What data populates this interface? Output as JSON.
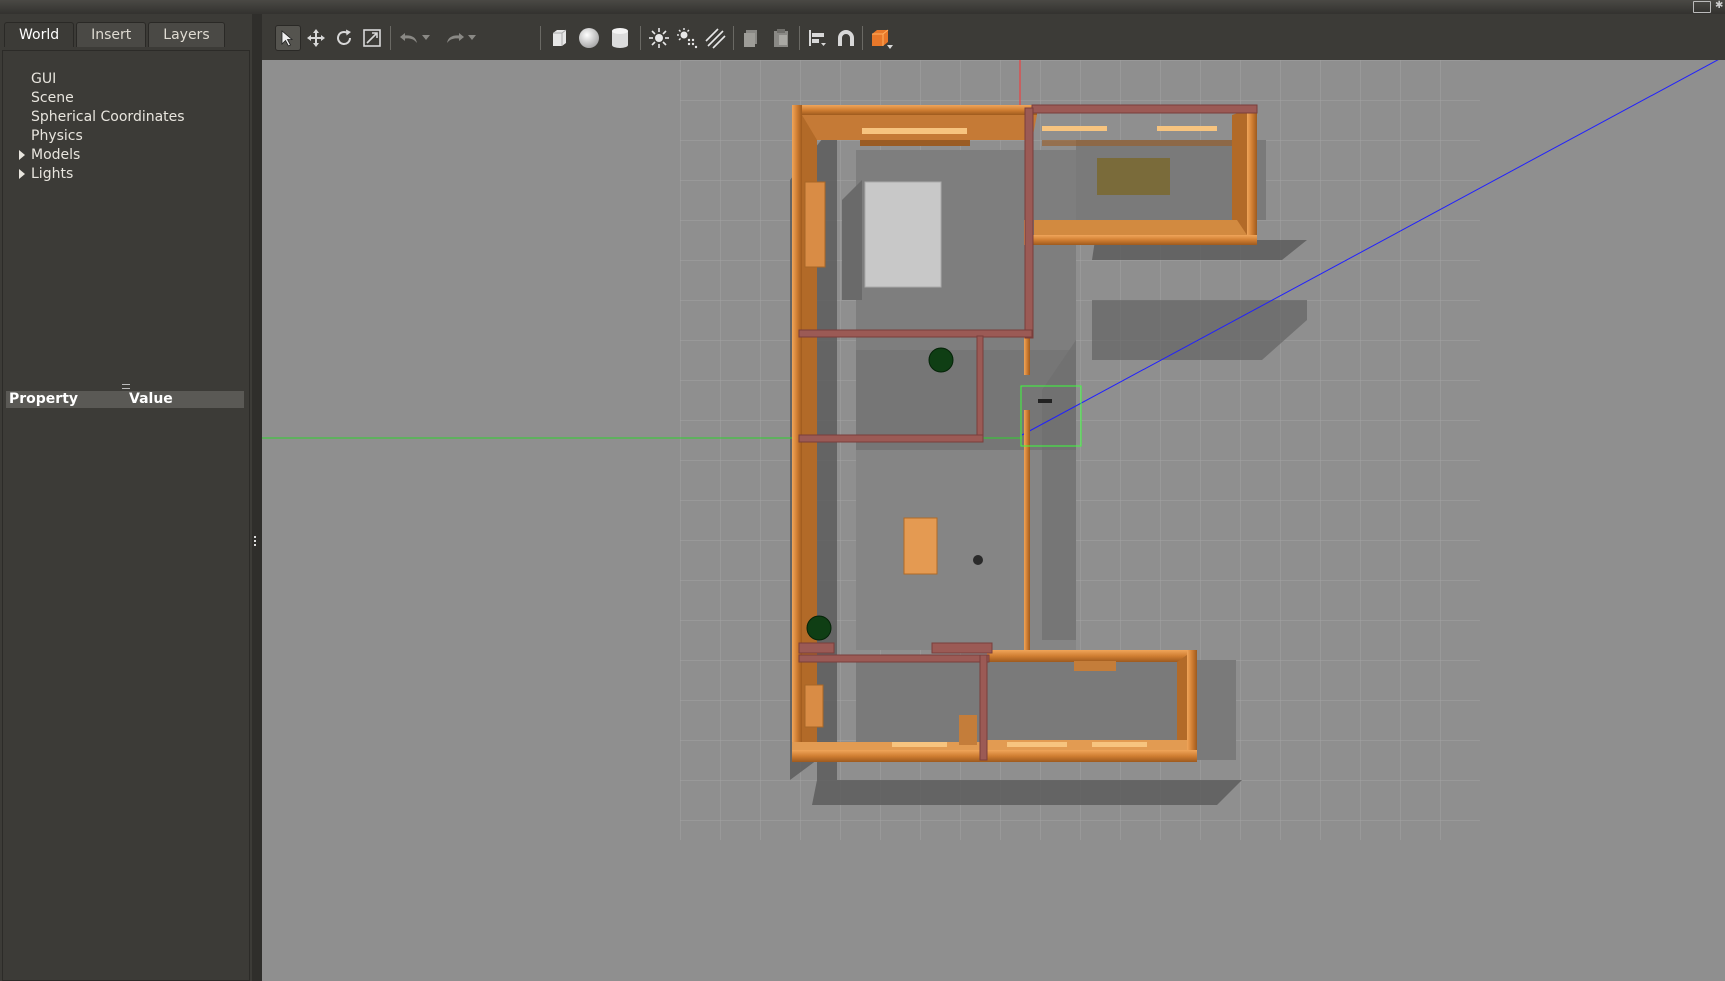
{
  "tabs": [
    {
      "label": "World",
      "active": true
    },
    {
      "label": "Insert",
      "active": false
    },
    {
      "label": "Layers",
      "active": false
    }
  ],
  "tree": {
    "items": [
      {
        "label": "GUI",
        "expandable": false
      },
      {
        "label": "Scene",
        "expandable": false
      },
      {
        "label": "Spherical Coordinates",
        "expandable": false
      },
      {
        "label": "Physics",
        "expandable": false
      },
      {
        "label": "Models",
        "expandable": true
      },
      {
        "label": "Lights",
        "expandable": true
      }
    ]
  },
  "properties": {
    "col_property": "Property",
    "col_value": "Value"
  },
  "toolbar": {
    "tools": [
      "select-mode-icon",
      "translate-mode-icon",
      "rotate-mode-icon",
      "scale-mode-icon",
      "undo-icon",
      "undo-history-icon",
      "redo-icon",
      "redo-history-icon",
      "box-shape-icon",
      "sphere-shape-icon",
      "cylinder-shape-icon",
      "point-light-icon",
      "spot-light-icon",
      "directional-light-icon",
      "copy-icon",
      "paste-icon",
      "align-icon",
      "snap-icon",
      "view-angle-icon"
    ]
  },
  "colors": {
    "panel_bg": "#3c3b37",
    "viewport_bg": "#8f8f8f",
    "grid_line": "#a3a3a3",
    "wall_wood": "#d2873c",
    "wall_brick": "#9b5a55",
    "selection_box": "#3cff3c",
    "x_axis": "#2020ff",
    "y_axis": "#2fd12f",
    "z_axis": "#ff3030"
  }
}
